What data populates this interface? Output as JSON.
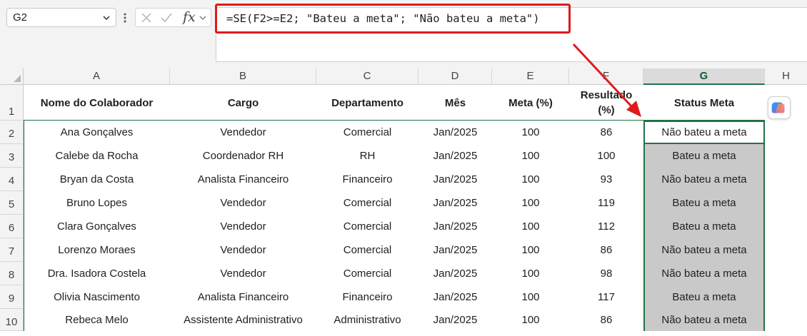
{
  "name_box": {
    "value": "G2"
  },
  "formula_bar": {
    "fx_label": "fx",
    "formula": "=SE(F2>=E2; \"Bateu a meta\"; \"Não bateu a meta\")"
  },
  "columns": [
    "A",
    "B",
    "C",
    "D",
    "E",
    "F",
    "G",
    "H"
  ],
  "selected_column": "G",
  "rows": [
    "1",
    "2",
    "3",
    "4",
    "5",
    "6",
    "7",
    "8",
    "9",
    "10"
  ],
  "table": {
    "headers": {
      "nome": "Nome do Colaborador",
      "cargo": "Cargo",
      "departamento": "Departamento",
      "mes": "Mês",
      "meta": "Meta (%)",
      "resultado": "Resultado (%)",
      "status": "Status Meta"
    },
    "data": [
      [
        "Ana Gonçalves",
        "Vendedor",
        "Comercial",
        "Jan/2025",
        "100",
        "86",
        "Não bateu a meta"
      ],
      [
        "Calebe da Rocha",
        "Coordenador RH",
        "RH",
        "Jan/2025",
        "100",
        "100",
        "Bateu a meta"
      ],
      [
        "Bryan da Costa",
        "Analista Financeiro",
        "Financeiro",
        "Jan/2025",
        "100",
        "93",
        "Não bateu a meta"
      ],
      [
        "Bruno Lopes",
        "Vendedor",
        "Comercial",
        "Jan/2025",
        "100",
        "119",
        "Bateu a meta"
      ],
      [
        "Clara Gonçalves",
        "Vendedor",
        "Comercial",
        "Jan/2025",
        "100",
        "112",
        "Bateu a meta"
      ],
      [
        "Lorenzo Moraes",
        "Vendedor",
        "Comercial",
        "Jan/2025",
        "100",
        "86",
        "Não bateu a meta"
      ],
      [
        "Dra. Isadora Costela",
        "Vendedor",
        "Comercial",
        "Jan/2025",
        "100",
        "98",
        "Não bateu a meta"
      ],
      [
        "Olivia Nascimento",
        "Analista Financeiro",
        "Financeiro",
        "Jan/2025",
        "100",
        "117",
        "Bateu a meta"
      ],
      [
        "Rebeca Melo",
        "Assistente Administrativo",
        "Administrativo",
        "Jan/2025",
        "100",
        "86",
        "Não bateu a meta"
      ]
    ]
  },
  "colors": {
    "highlight_red": "#e01b1b",
    "selection_green": "#217346",
    "selected_fill": "#c9c9c9"
  },
  "icons": {
    "name_box_dropdown": "chevron-down-icon",
    "cancel": "close-icon",
    "enter": "check-icon",
    "copilot": "copilot-icon",
    "annotation": "arrow-icon"
  }
}
